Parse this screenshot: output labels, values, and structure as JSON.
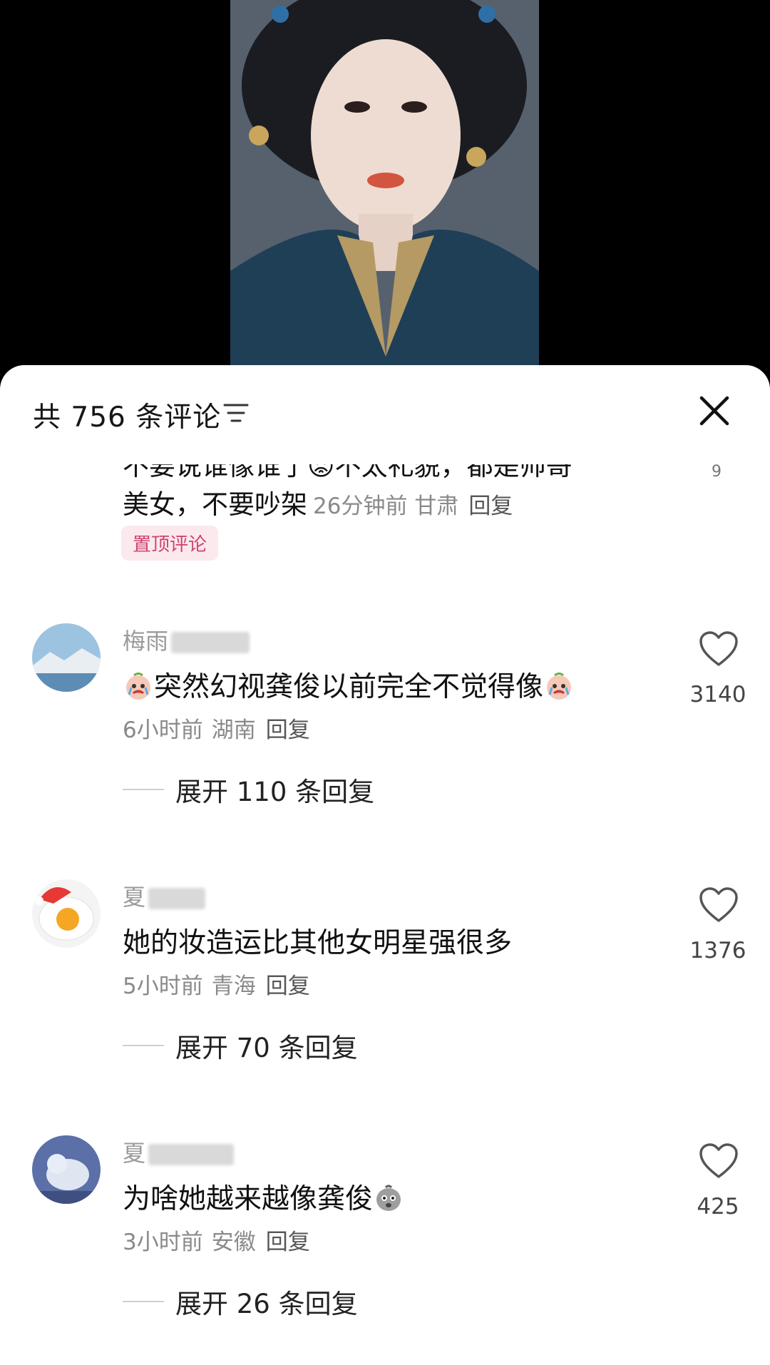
{
  "header": {
    "comment_count": "共 756 条评论"
  },
  "pinned_comment": {
    "cut_text": "不要说谁像谁了😡不太礼貌，都是帅哥",
    "text": "美女，不要吵架",
    "time": "26分钟前",
    "region": "甘肃",
    "reply_label": "回复",
    "badge": "置顶评论",
    "likes": "9"
  },
  "comments": [
    {
      "username": "梅雨",
      "text": "突然幻视龚俊以前完全不觉得像",
      "time": "6小时前",
      "region": "湖南",
      "reply_label": "回复",
      "likes": "3140",
      "expand_label": "展开 110 条回复"
    },
    {
      "username": "夏",
      "text": "她的妆造运比其他女明星强很多",
      "time": "5小时前",
      "region": "青海",
      "reply_label": "回复",
      "likes": "1376",
      "expand_label": "展开 70 条回复"
    },
    {
      "username": "夏",
      "text": "为啥她越来越像龚俊",
      "time": "3小时前",
      "region": "安徽",
      "reply_label": "回复",
      "likes": "425",
      "expand_label": "展开 26 条回复"
    }
  ],
  "colors": {
    "badge_bg": "#fbe9ee",
    "badge_text": "#d0456c",
    "meta_gray": "#8a8a8a"
  }
}
